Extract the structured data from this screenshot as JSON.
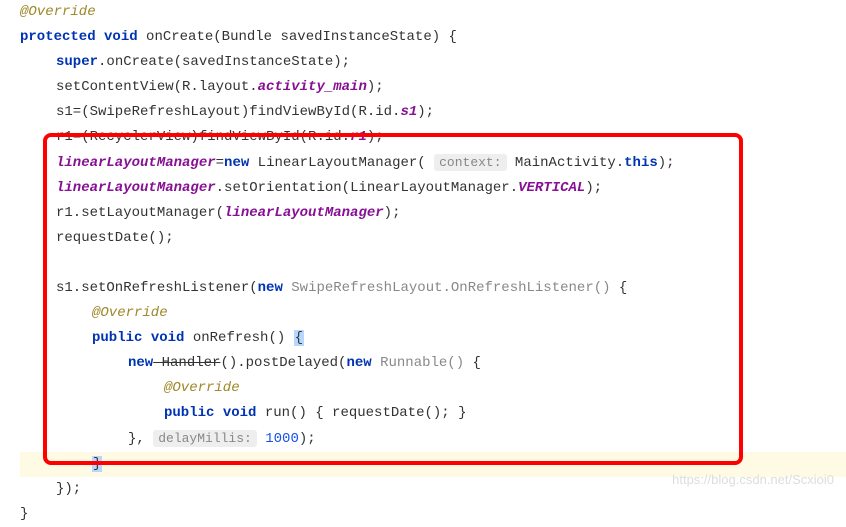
{
  "code": {
    "annotation_override": "@Override",
    "line1": {
      "protected": "protected",
      "void": "void",
      "method": "onCreate",
      "param_type": "Bundle",
      "param_name": "savedInstanceState",
      "brace": " {"
    },
    "line2": {
      "super": "super",
      "dot_onCreate": ".onCreate(savedInstanceState);"
    },
    "line3": {
      "text1": "setContentView(R.layout.",
      "activity_main": "activity_main",
      "text2": ");"
    },
    "line4": {
      "text1": "s1=(SwipeRefreshLayout)findViewById(R.id.",
      "s1": "s1",
      "text2": ");"
    },
    "line5": {
      "text1": "r1=(RecyclerView)findViewById(R.id.",
      "r1": "r1",
      "text2": ");"
    },
    "line6": {
      "llm": "linearLayoutManager",
      "eq_new": "=",
      "new": "new",
      "space_type": " LinearLayoutManager( ",
      "hint": "context:",
      "main_this": " MainActivity.",
      "this": "this",
      "close": ");"
    },
    "line7": {
      "llm": "linearLayoutManager",
      "text1": ".setOrientation(LinearLayoutManager.",
      "vertical": "VERTICAL",
      "text2": ");"
    },
    "line8": {
      "text1": "r1.setLayoutManager(",
      "llm": "linearLayoutManager",
      "text2": ");"
    },
    "line9": {
      "text": "requestDate();"
    },
    "line11": {
      "text1": "s1.setOnRefreshListener(",
      "new": "new",
      "space": " ",
      "type_hint": "SwipeRefreshLayout.OnRefreshListener()",
      "brace": " {"
    },
    "line12_override": "@Override",
    "line13": {
      "public": "public",
      "void": "void",
      "method": " onRefresh() ",
      "brace": "{"
    },
    "line14": {
      "new1": "new",
      "handler": " Handler",
      "postDelayed": "().postDelayed(",
      "new2": "new",
      "runnable_hint": " Runnable()",
      "brace": " {"
    },
    "line15_override": "@Override",
    "line16": {
      "public": "public",
      "void": "void",
      "text": " run() { requestDate(); }"
    },
    "line17": {
      "close": "}, ",
      "hint": "delayMillis:",
      "value": " 1000",
      "end": ");"
    },
    "line18_brace": "}",
    "line19_close": "});",
    "line20_brace": "}"
  },
  "watermark": "https://blog.csdn.net/Scxioi0"
}
